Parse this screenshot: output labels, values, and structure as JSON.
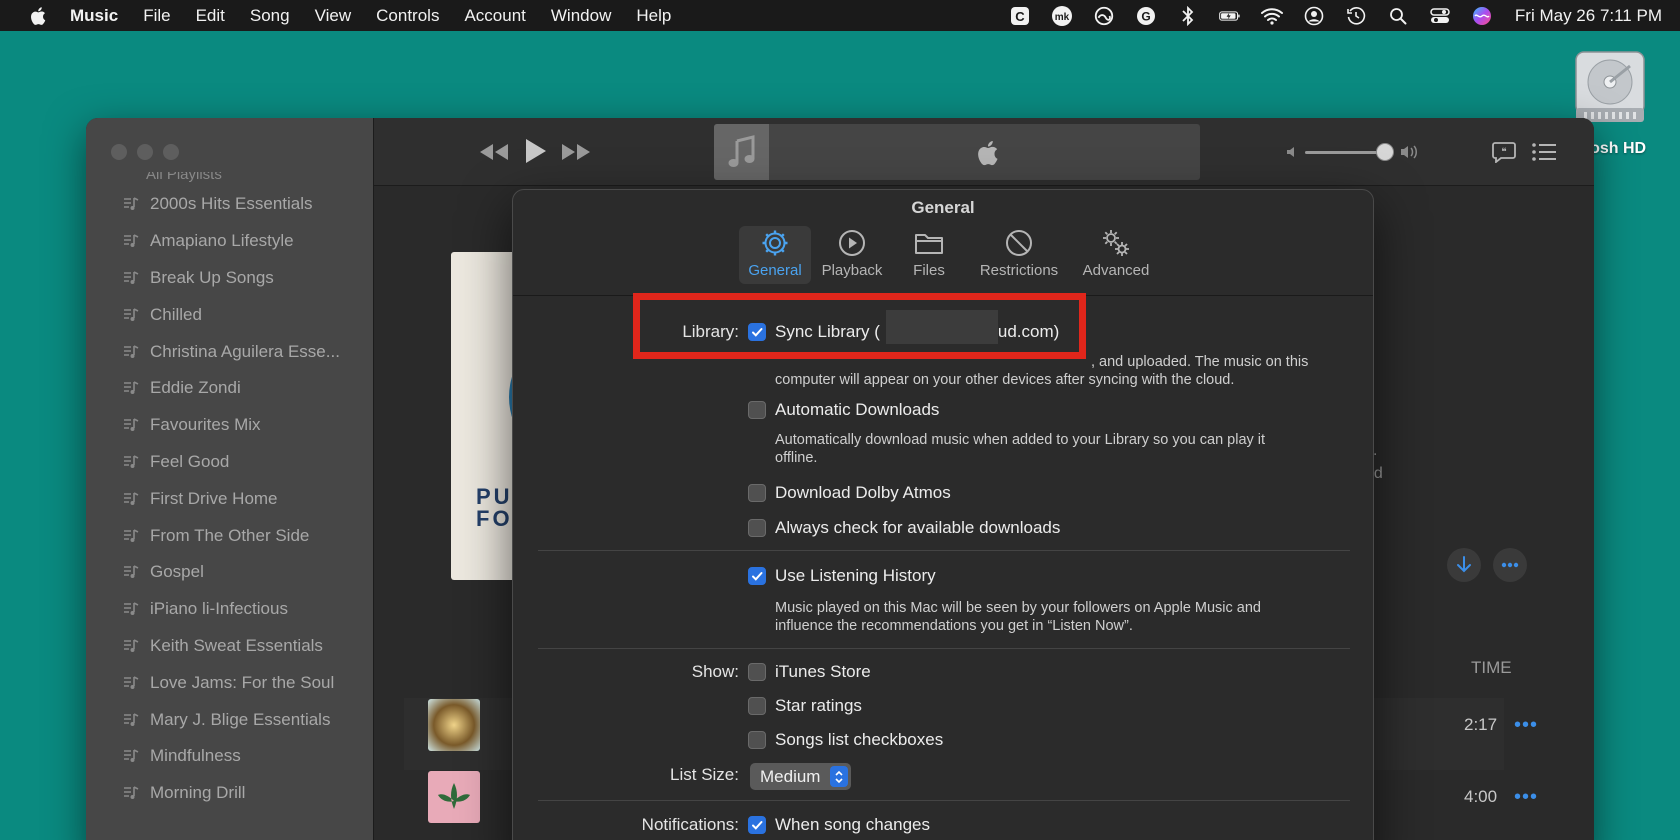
{
  "menubar": {
    "app_name": "Music",
    "items": [
      "File",
      "Edit",
      "Song",
      "View",
      "Controls",
      "Account",
      "Window",
      "Help"
    ],
    "clock": "Fri May 26  7:11 PM",
    "status_icons": [
      "creative-cloud-c-icon",
      "mk-icon",
      "adobe-cloud-icon",
      "grammarly-icon",
      "bluetooth-icon",
      "battery-icon",
      "wifi-icon",
      "user-icon",
      "time-machine-icon",
      "spotlight-search-icon",
      "control-center-icon",
      "siri-icon"
    ]
  },
  "desktop": {
    "drive_label": "ntosh HD"
  },
  "sidebar": {
    "cut_top": "All Playlists",
    "playlists": [
      "2000s Hits Essentials",
      "Amapiano Lifestyle",
      "Break Up Songs",
      "Chilled",
      "Christina Aguilera Esse...",
      "Eddie Zondi",
      "Favourites Mix",
      "Feel Good",
      "First Drive Home",
      "From The Other Side",
      "Gospel",
      "iPiano li-Infectious",
      "Keith Sweat Essentials",
      "Love Jams: For the Soul",
      "Mary J. Blige Essentials",
      "Mindfulness",
      "Morning Drill"
    ]
  },
  "main": {
    "album_text": "PUR\nFOO",
    "bg_text_1": "s.",
    "bg_text_2": "dd",
    "song_header_partial": "S",
    "time_header": "TIME",
    "songs": [
      {
        "title_partial": "li",
        "time": "2:17"
      },
      {
        "title_partial": "H",
        "time": "4:00"
      }
    ],
    "more_glyph": "•••"
  },
  "dialog": {
    "title": "General",
    "tabs": [
      {
        "label": "General",
        "active": true
      },
      {
        "label": "Playback",
        "active": false
      },
      {
        "label": "Files",
        "active": false
      },
      {
        "label": "Restrictions",
        "active": false
      },
      {
        "label": "Advanced",
        "active": false
      }
    ],
    "library_label": "Library:",
    "sync_library_prefix": "Sync Library (",
    "sync_library_suffix": "ud.com)",
    "sync_desc_partial": ", and uploaded. The music on this",
    "sync_desc_line2": "computer will appear on your other devices after syncing with the cloud.",
    "auto_downloads": "Automatic Downloads",
    "auto_downloads_desc": "Automatically download music when added to your Library so you can play it offline.",
    "dolby": "Download Dolby Atmos",
    "always_check": "Always check for available downloads",
    "listening_history": "Use Listening History",
    "listening_desc": "Music played on this Mac will be seen by your followers on Apple Music and influence the recommendations you get in “Listen Now”.",
    "show_label": "Show:",
    "itunes_store": "iTunes Store",
    "star_ratings": "Star ratings",
    "songs_checkboxes": "Songs list checkboxes",
    "list_size_label": "List Size:",
    "list_size_value": "Medium",
    "notifications_label": "Notifications:",
    "when_song_changes": "When song changes",
    "checked": {
      "sync_library": true,
      "auto_downloads": false,
      "dolby": false,
      "always_check": false,
      "listening_history": true,
      "itunes_store": false,
      "star_ratings": false,
      "songs_checkboxes": false,
      "when_song_changes": true
    }
  },
  "colors": {
    "desktop": "#0a8a80",
    "accent": "#2a72e0",
    "highlight": "#e0261b",
    "link_blue": "#3b8ee8"
  }
}
